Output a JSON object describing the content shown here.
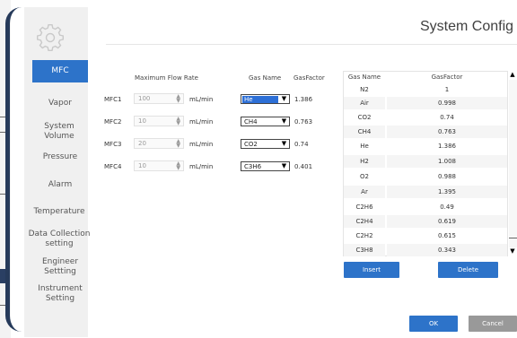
{
  "window": {
    "title": "System Config"
  },
  "sidebar": {
    "icon": "gear-icon",
    "items": [
      {
        "label": "MFC",
        "active": true
      },
      {
        "label": "Vapor"
      },
      {
        "label": "System Volume"
      },
      {
        "label": "Pressure"
      },
      {
        "label": "Alarm"
      },
      {
        "label": "Temperature"
      },
      {
        "label": "Data Collection setting"
      },
      {
        "label": "Engineer Settting"
      },
      {
        "label": "Instrument Setting"
      }
    ]
  },
  "mfc_table": {
    "headers": {
      "flow": "Maximum Flow Rate",
      "gas": "Gas Name",
      "factor": "GasFactor"
    },
    "unit": "mL/min",
    "rows": [
      {
        "name": "MFC1",
        "flow": "100",
        "gas": "He",
        "factor": "1.386",
        "focused": true
      },
      {
        "name": "MFC2",
        "flow": "10",
        "gas": "CH4",
        "factor": "0.763"
      },
      {
        "name": "MFC3",
        "flow": "20",
        "gas": "CO2",
        "factor": "0.74"
      },
      {
        "name": "MFC4",
        "flow": "10",
        "gas": "C3H6",
        "factor": "0.401"
      }
    ]
  },
  "gas_table": {
    "headers": {
      "name": "Gas Name",
      "factor": "GasFactor"
    },
    "rows": [
      {
        "name": "N2",
        "factor": "1"
      },
      {
        "name": "Air",
        "factor": "0.998"
      },
      {
        "name": "CO2",
        "factor": "0.74"
      },
      {
        "name": "CH4",
        "factor": "0.763"
      },
      {
        "name": "He",
        "factor": "1.386"
      },
      {
        "name": "H2",
        "factor": "1.008"
      },
      {
        "name": "O2",
        "factor": "0.988"
      },
      {
        "name": "Ar",
        "factor": "1.395"
      },
      {
        "name": "C2H6",
        "factor": "0.49"
      },
      {
        "name": "C2H4",
        "factor": "0.619"
      },
      {
        "name": "C2H2",
        "factor": "0.615"
      },
      {
        "name": "C3H8",
        "factor": "0.343"
      }
    ],
    "insert_label": "Insert",
    "delete_label": "Delete"
  },
  "footer": {
    "ok_label": "OK",
    "cancel_label": "Cancel"
  },
  "colors": {
    "accent": "#2d73c9",
    "sidebar_bg": "#f0f0f0",
    "window_frame": "#263a5a"
  }
}
